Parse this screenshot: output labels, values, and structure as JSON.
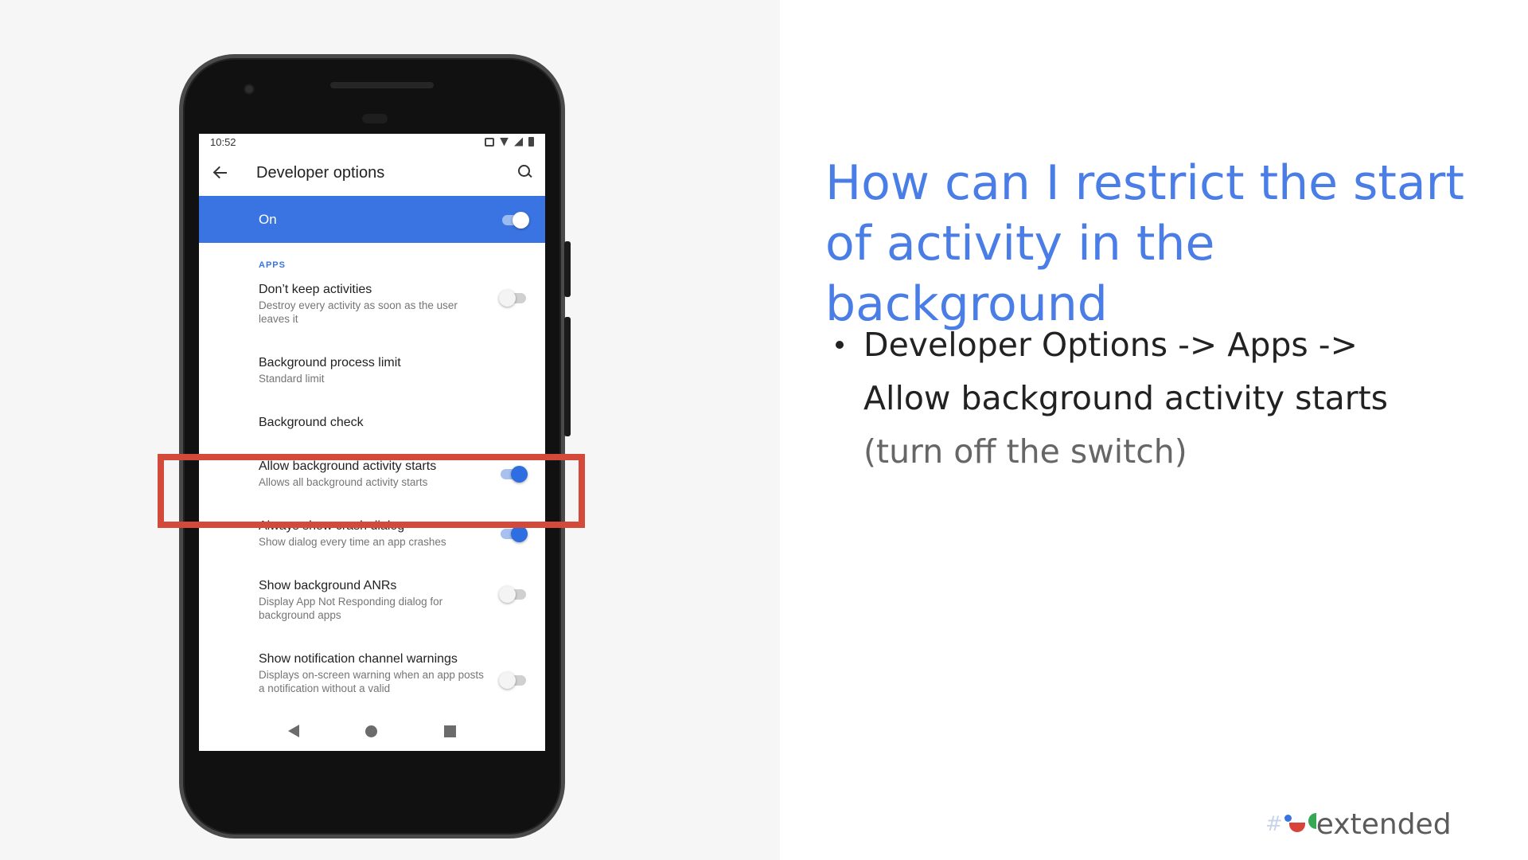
{
  "phone": {
    "status_time": "10:52",
    "appbar_title": "Developer options",
    "master_label": "On",
    "master_on": true,
    "section_label": "APPS",
    "settings": [
      {
        "title": "Don’t keep activities",
        "summary": "Destroy every activity as soon as the user leaves it",
        "toggle": "off"
      },
      {
        "title": "Background process limit",
        "summary": "Standard limit",
        "toggle": "none"
      },
      {
        "title": "Background check",
        "summary": "",
        "toggle": "none"
      },
      {
        "title": "Allow background activity starts",
        "summary": "Allows all background activity starts",
        "toggle": "on"
      },
      {
        "title": "Always show crash dialog",
        "summary": "Show dialog every time an app crashes",
        "toggle": "on"
      },
      {
        "title": "Show background ANRs",
        "summary": "Display App Not Responding dialog for background apps",
        "toggle": "off"
      },
      {
        "title": "Show notification channel warnings",
        "summary": "Displays on-screen warning when an app posts a notification without a valid",
        "toggle": "off"
      }
    ],
    "icons": [
      "back-arrow-icon",
      "search-icon",
      "vibrate-icon",
      "wifi-icon",
      "signal-icon",
      "battery-icon",
      "nav-back-icon",
      "nav-home-icon",
      "nav-recents-icon"
    ]
  },
  "slide": {
    "headline": "How can I restrict the start of activity in the background",
    "bullet_line1": "Developer Options -> Apps ->",
    "bullet_line2": "Allow background activity starts",
    "bullet_note": "(turn off the switch)",
    "brand_hash": "#",
    "brand_text": "extended"
  },
  "colors": {
    "accent_blue": "#3a74e2",
    "headline_blue": "#4a7ee6",
    "highlight_red": "#d44a3a"
  }
}
